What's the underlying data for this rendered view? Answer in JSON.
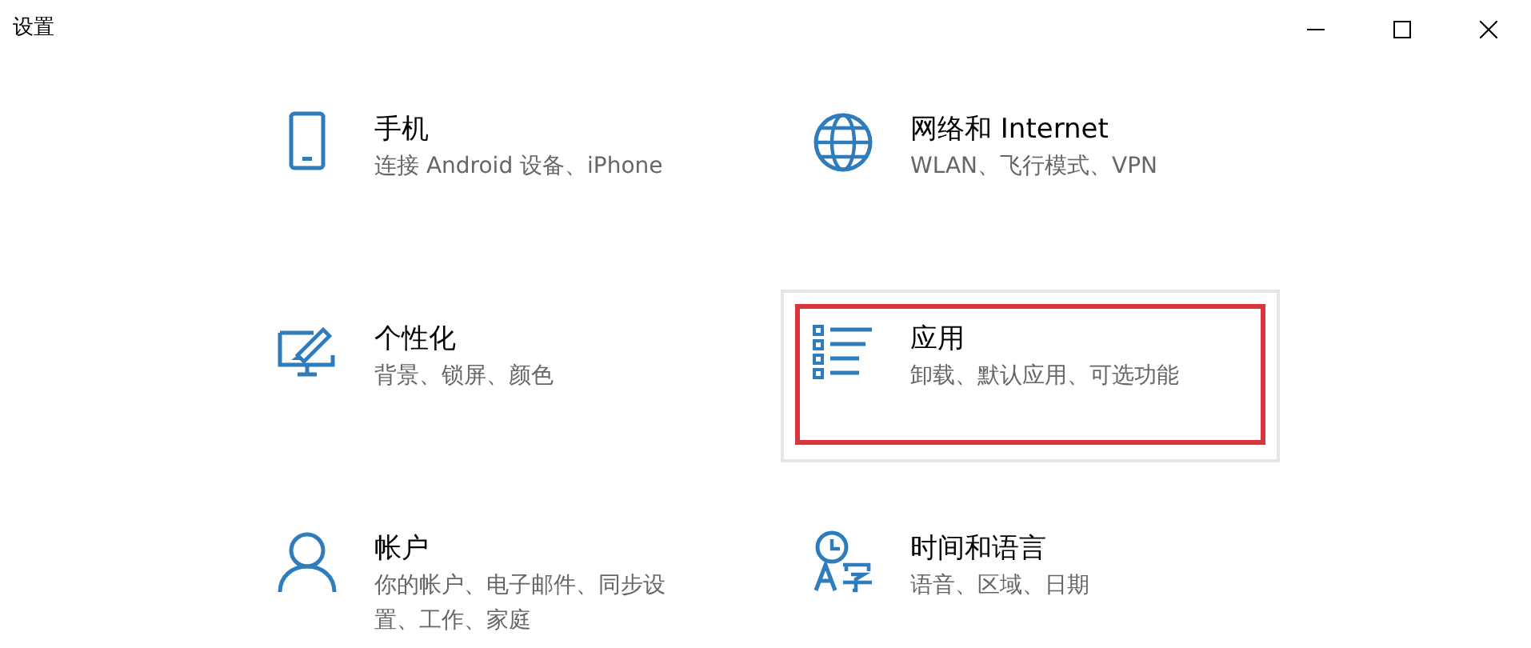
{
  "window": {
    "title": "设置"
  },
  "items": [
    {
      "title": "手机",
      "subtitle": "连接 Android 设备、iPhone",
      "selected": false,
      "highlighted": false
    },
    {
      "title": "网络和 Internet",
      "subtitle": "WLAN、飞行模式、VPN",
      "selected": false,
      "highlighted": false
    },
    {
      "title": "个性化",
      "subtitle": "背景、锁屏、颜色",
      "selected": false,
      "highlighted": false
    },
    {
      "title": "应用",
      "subtitle": "卸载、默认应用、可选功能",
      "selected": true,
      "highlighted": true
    },
    {
      "title": "帐户",
      "subtitle": "你的帐户、电子邮件、同步设置、工作、家庭",
      "selected": false,
      "highlighted": false
    },
    {
      "title": "时间和语言",
      "subtitle": "语音、区域、日期",
      "selected": false,
      "highlighted": false
    }
  ]
}
